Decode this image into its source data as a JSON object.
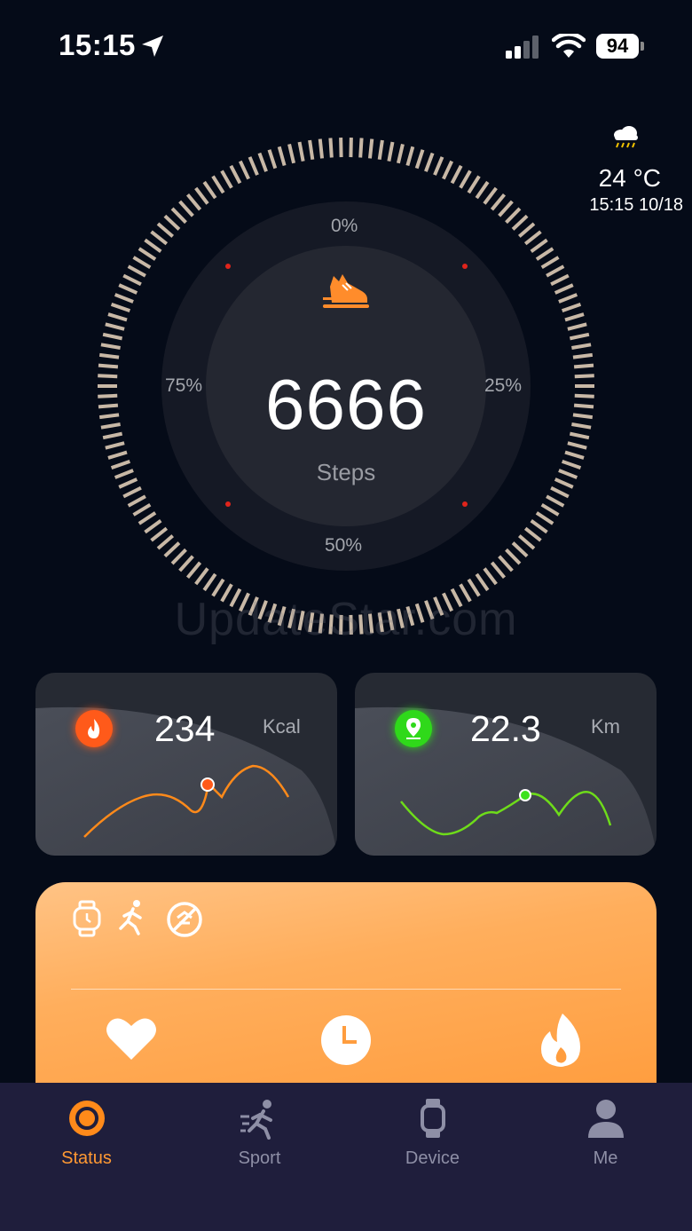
{
  "status_bar": {
    "time": "15:15",
    "battery": "94"
  },
  "weather": {
    "icon": "cloud-rain-icon",
    "temperature": "24 °C",
    "datetime": "15:15 10/18"
  },
  "dial": {
    "ticks": [
      "0%",
      "25%",
      "50%",
      "75%"
    ],
    "steps": "6666",
    "steps_label": "Steps",
    "icon": "shoe-icon"
  },
  "watermark": "UpdateStar.com",
  "cards": {
    "calories": {
      "icon": "flame-icon",
      "value": "234",
      "unit": "Kcal",
      "color": "#ff7a1a"
    },
    "distance": {
      "icon": "location-pin-icon",
      "value": "22.3",
      "unit": "Km",
      "color": "#3ee21d"
    }
  },
  "activity_panel": {
    "top_icons": [
      "watch-icon",
      "running-icon",
      "no-disturb-icon"
    ],
    "bottom_icons": [
      "heart-icon",
      "clock-icon",
      "flame-icon"
    ],
    "accent": "#ffa445"
  },
  "tabs": [
    {
      "label": "Status",
      "icon": "status-ring-icon",
      "active": true
    },
    {
      "label": "Sport",
      "icon": "sport-running-icon",
      "active": false
    },
    {
      "label": "Device",
      "icon": "watch-device-icon",
      "active": false
    },
    {
      "label": "Me",
      "icon": "person-icon",
      "active": false
    }
  ]
}
